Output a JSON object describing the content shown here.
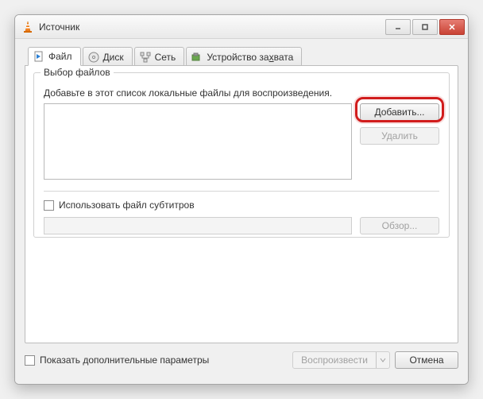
{
  "titlebar": {
    "title": "Источник"
  },
  "tabs": {
    "file": "Файл",
    "disc": "Диск",
    "network": "Сеть",
    "capture_pre": "Устройство за",
    "capture_key": "х",
    "capture_post": "вата"
  },
  "group": {
    "title": "Выбор файлов",
    "hint": "Добавьте в этот список локальные файлы для воспроизведения.",
    "add_btn": "Добавить...",
    "delete_btn": "Удалить"
  },
  "subtitles": {
    "checkbox_label": "Использовать файл субтитров",
    "browse_btn": "Обзор..."
  },
  "footer": {
    "show_more": "Показать дополнительные параметры",
    "play_btn": "Воспроизвести",
    "cancel_btn": "Отмена"
  }
}
